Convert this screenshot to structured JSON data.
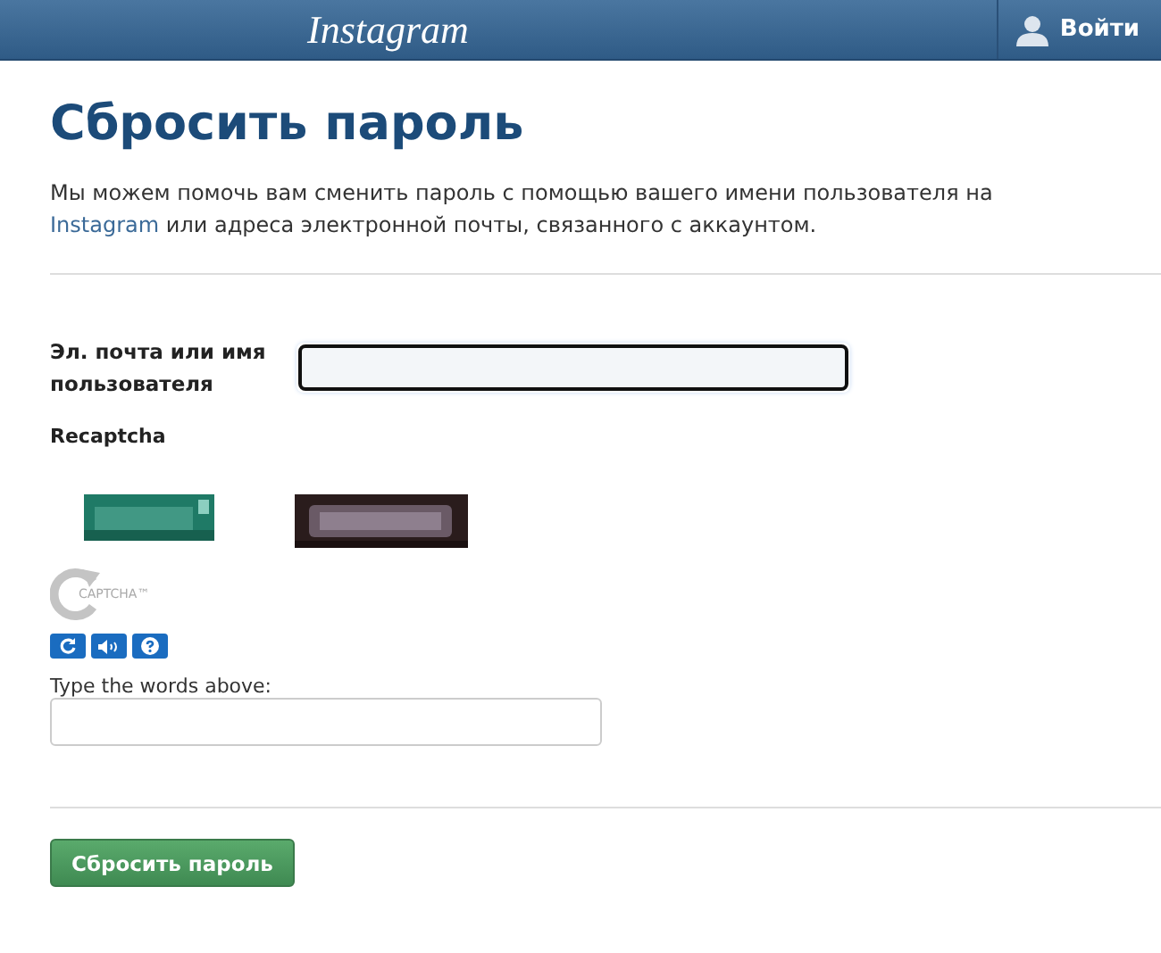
{
  "header": {
    "logo": "Instagram",
    "login_button": "Войти"
  },
  "title": "Сбросить пароль",
  "intro": {
    "before": "Мы можем помочь вам сменить пароль с помощью вашего имени пользователя на",
    "link": "Instagram",
    "after": "или адреса электронной почты, связанного с аккаунтом."
  },
  "form": {
    "username_label": "Эл. почта или имя пользователя",
    "username_field": {
      "focused": true
    },
    "captcha_label": "Recaptcha",
    "captcha": {
      "logo_text": "CAPTCHA™",
      "tools": [
        {
          "kind": "reload"
        },
        {
          "kind": "audio"
        },
        {
          "kind": "help"
        }
      ],
      "answer_label": "Type the words above:"
    }
  },
  "submit_button": "Сбросить пароль"
}
